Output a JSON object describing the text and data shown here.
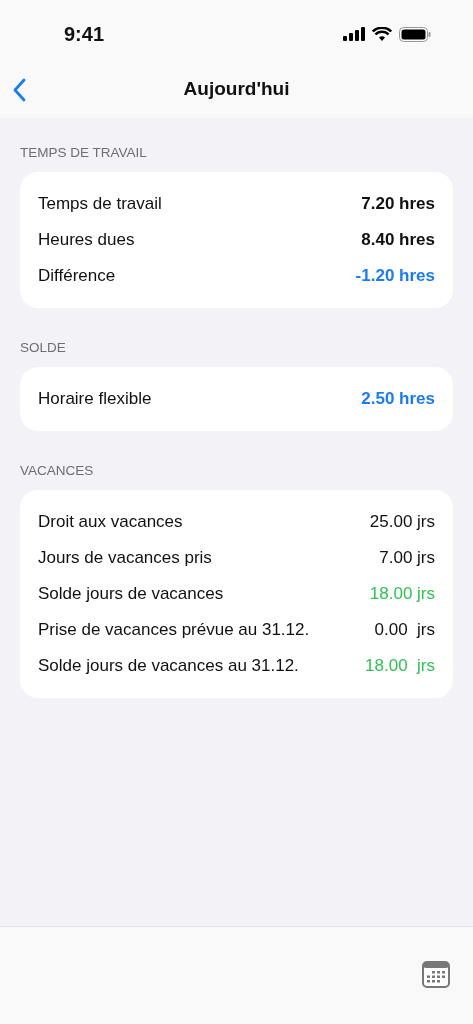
{
  "status_bar": {
    "time": "9:41"
  },
  "nav": {
    "title": "Aujourd'hui"
  },
  "sections": [
    {
      "header": "TEMPS DE TRAVAIL",
      "rows": [
        {
          "label": "Temps de travail",
          "value": "7.20 hres",
          "color": "#111111",
          "bold": true
        },
        {
          "label": "Heures dues",
          "value": "8.40 hres",
          "color": "#111111",
          "bold": true
        },
        {
          "label": "Différence",
          "value": "-1.20 hres",
          "color": "#1a7cf0",
          "bold": true
        }
      ]
    },
    {
      "header": "SOLDE",
      "rows": [
        {
          "label": "Horaire flexible",
          "value": "2.50 hres",
          "color": "#1a7cf0",
          "bold": true
        }
      ]
    },
    {
      "header": "VACANCES",
      "rows": [
        {
          "label": "Droit aux vacances",
          "value": "25.00 jrs",
          "color": "#111111",
          "bold": false
        },
        {
          "label": "Jours de vacances pris",
          "value": "7.00 jrs",
          "color": "#111111",
          "bold": false
        },
        {
          "label": "Solde jours de vacances",
          "value": "18.00 jrs",
          "color": "#2fc152",
          "bold": false
        },
        {
          "label": "Prise de vacances prévue au 31.12.",
          "value": "0.00  jrs",
          "color": "#111111",
          "bold": false
        },
        {
          "label": "Solde jours de vacances au 31.12.",
          "value": "18.00  jrs",
          "color": "#2fc152",
          "bold": false
        }
      ]
    }
  ]
}
